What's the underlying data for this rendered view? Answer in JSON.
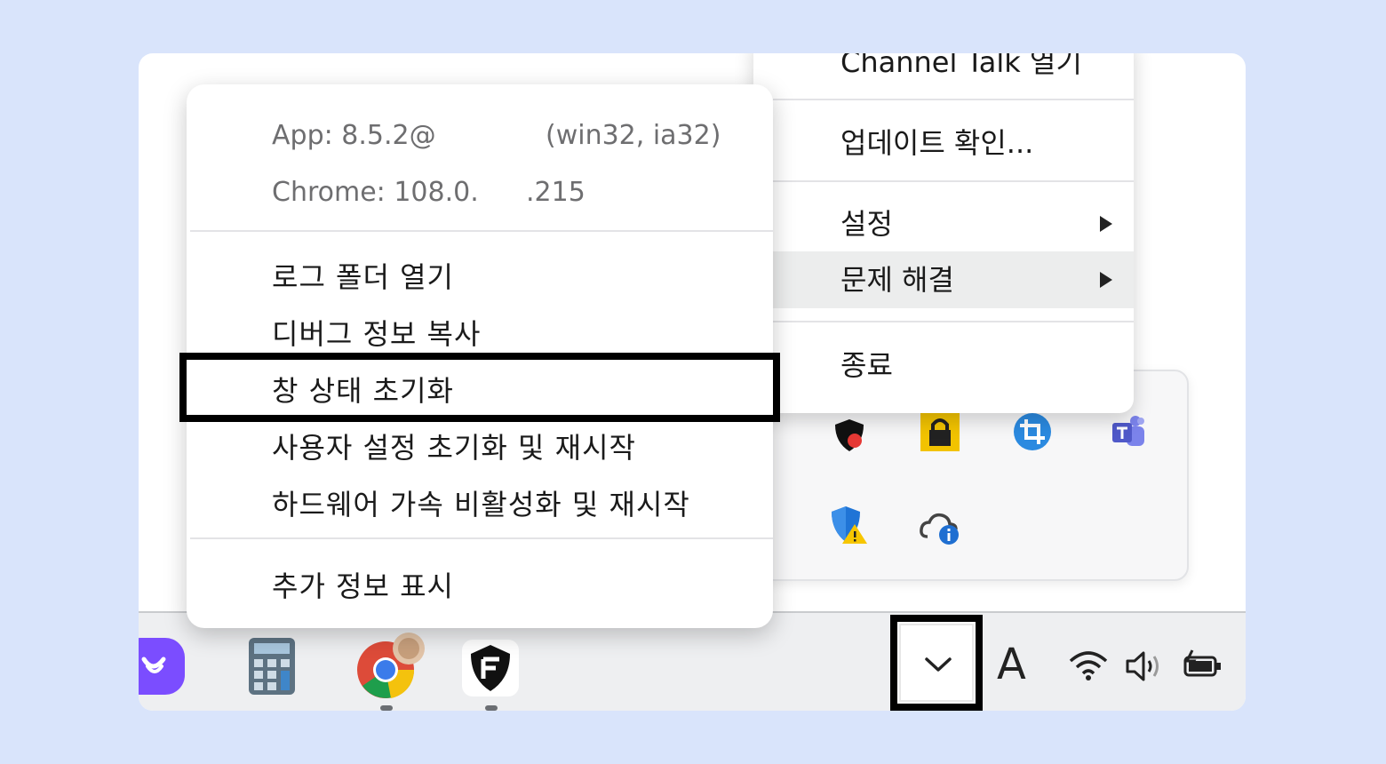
{
  "colors": {
    "page_bg": "#d9e4fb",
    "hover_row": "#eceded",
    "highlight_border": "#000000"
  },
  "main_menu": {
    "items": [
      {
        "label": "Channel Talk 열기"
      },
      {
        "label": "업데이트 확인..."
      },
      {
        "label": "설정",
        "has_submenu": true
      },
      {
        "label": "문제 해결",
        "has_submenu": true,
        "state": "hovered"
      },
      {
        "label": "종료"
      }
    ]
  },
  "submenu": {
    "info_lines": [
      {
        "left": "App: 8.5.2@",
        "right": "(win32, ia32)"
      },
      {
        "left": "Chrome: 108.0.",
        "right": ".215"
      }
    ],
    "items": [
      {
        "label": "로그 폴더 열기"
      },
      {
        "label": "디버그 정보 복사"
      },
      {
        "label": "창 상태 초기화",
        "state": "highlighted"
      },
      {
        "label": "사용자 설정 초기화 및 재시작"
      },
      {
        "label": "하드웨어 가속 비활성화 및 재시작"
      },
      {
        "label": "추가 정보 표시"
      }
    ]
  },
  "tray_overflow": {
    "icons": [
      "shield-badge-icon",
      "lock-icon",
      "crop-icon",
      "teams-icon",
      "windows-security-warning-icon",
      "onedrive-info-icon"
    ]
  },
  "taskbar": {
    "apps": [
      "channel-talk-icon",
      "calculator-icon",
      "chrome-icon",
      "shield-app-icon"
    ],
    "tray": {
      "input_indicator": "A",
      "icons": [
        "wifi-icon",
        "volume-icon",
        "battery-icon"
      ]
    }
  }
}
